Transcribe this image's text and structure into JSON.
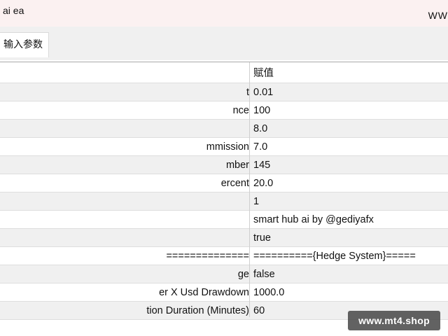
{
  "window": {
    "title": "ai ea",
    "title_right": "WW"
  },
  "tabs": [
    {
      "label": "输入参数"
    }
  ],
  "table": {
    "value_header": "赋值",
    "rows": [
      {
        "name": "t",
        "value": "0.01"
      },
      {
        "name": "nce",
        "value": "100"
      },
      {
        "name": "",
        "value": "8.0"
      },
      {
        "name": "mmission",
        "value": "7.0"
      },
      {
        "name": "mber",
        "value": "145"
      },
      {
        "name": "ercent",
        "value": "20.0"
      },
      {
        "name": "",
        "value": "1"
      },
      {
        "name": "",
        "value": "smart hub ai by @gediyafx"
      },
      {
        "name": "",
        "value": "true"
      },
      {
        "name": "==============",
        "value": "=========={Hedge System}====="
      },
      {
        "name": "ge",
        "value": "false"
      },
      {
        "name": "er X Usd Drawdown",
        "value": "1000.0"
      },
      {
        "name": "tion Duration (Minutes)",
        "value": "60"
      }
    ]
  },
  "watermark": {
    "text": "www.mt4.shop"
  }
}
